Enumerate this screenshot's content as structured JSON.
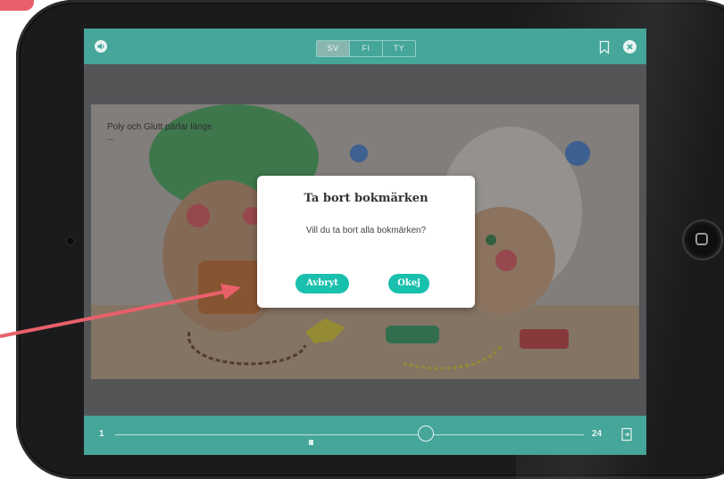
{
  "top_bar": {
    "languages": [
      {
        "code": "SV",
        "active": true
      },
      {
        "code": "FI",
        "active": false
      },
      {
        "code": "TY",
        "active": false
      }
    ],
    "icons": [
      "speaker-icon",
      "bookmark-icon",
      "close-icon"
    ]
  },
  "page": {
    "text": "Poly och Glutt pärlar länge ..."
  },
  "dialog": {
    "title": "Ta bort bokmärken",
    "message": "Vill du ta bort alla bokmärken?",
    "cancel_label": "Avbryt",
    "ok_label": "Okej"
  },
  "bottom_bar": {
    "start_page": "1",
    "end_page": "24",
    "current_progress_fraction": 0.66,
    "icons": [
      "bookmark-marker-icon",
      "exit-icon"
    ]
  },
  "colors": {
    "bar_teal": "#45a699",
    "button_teal": "#19c0ad",
    "arrow_red": "#e9606a",
    "tablet_black": "#1b1b1d"
  }
}
